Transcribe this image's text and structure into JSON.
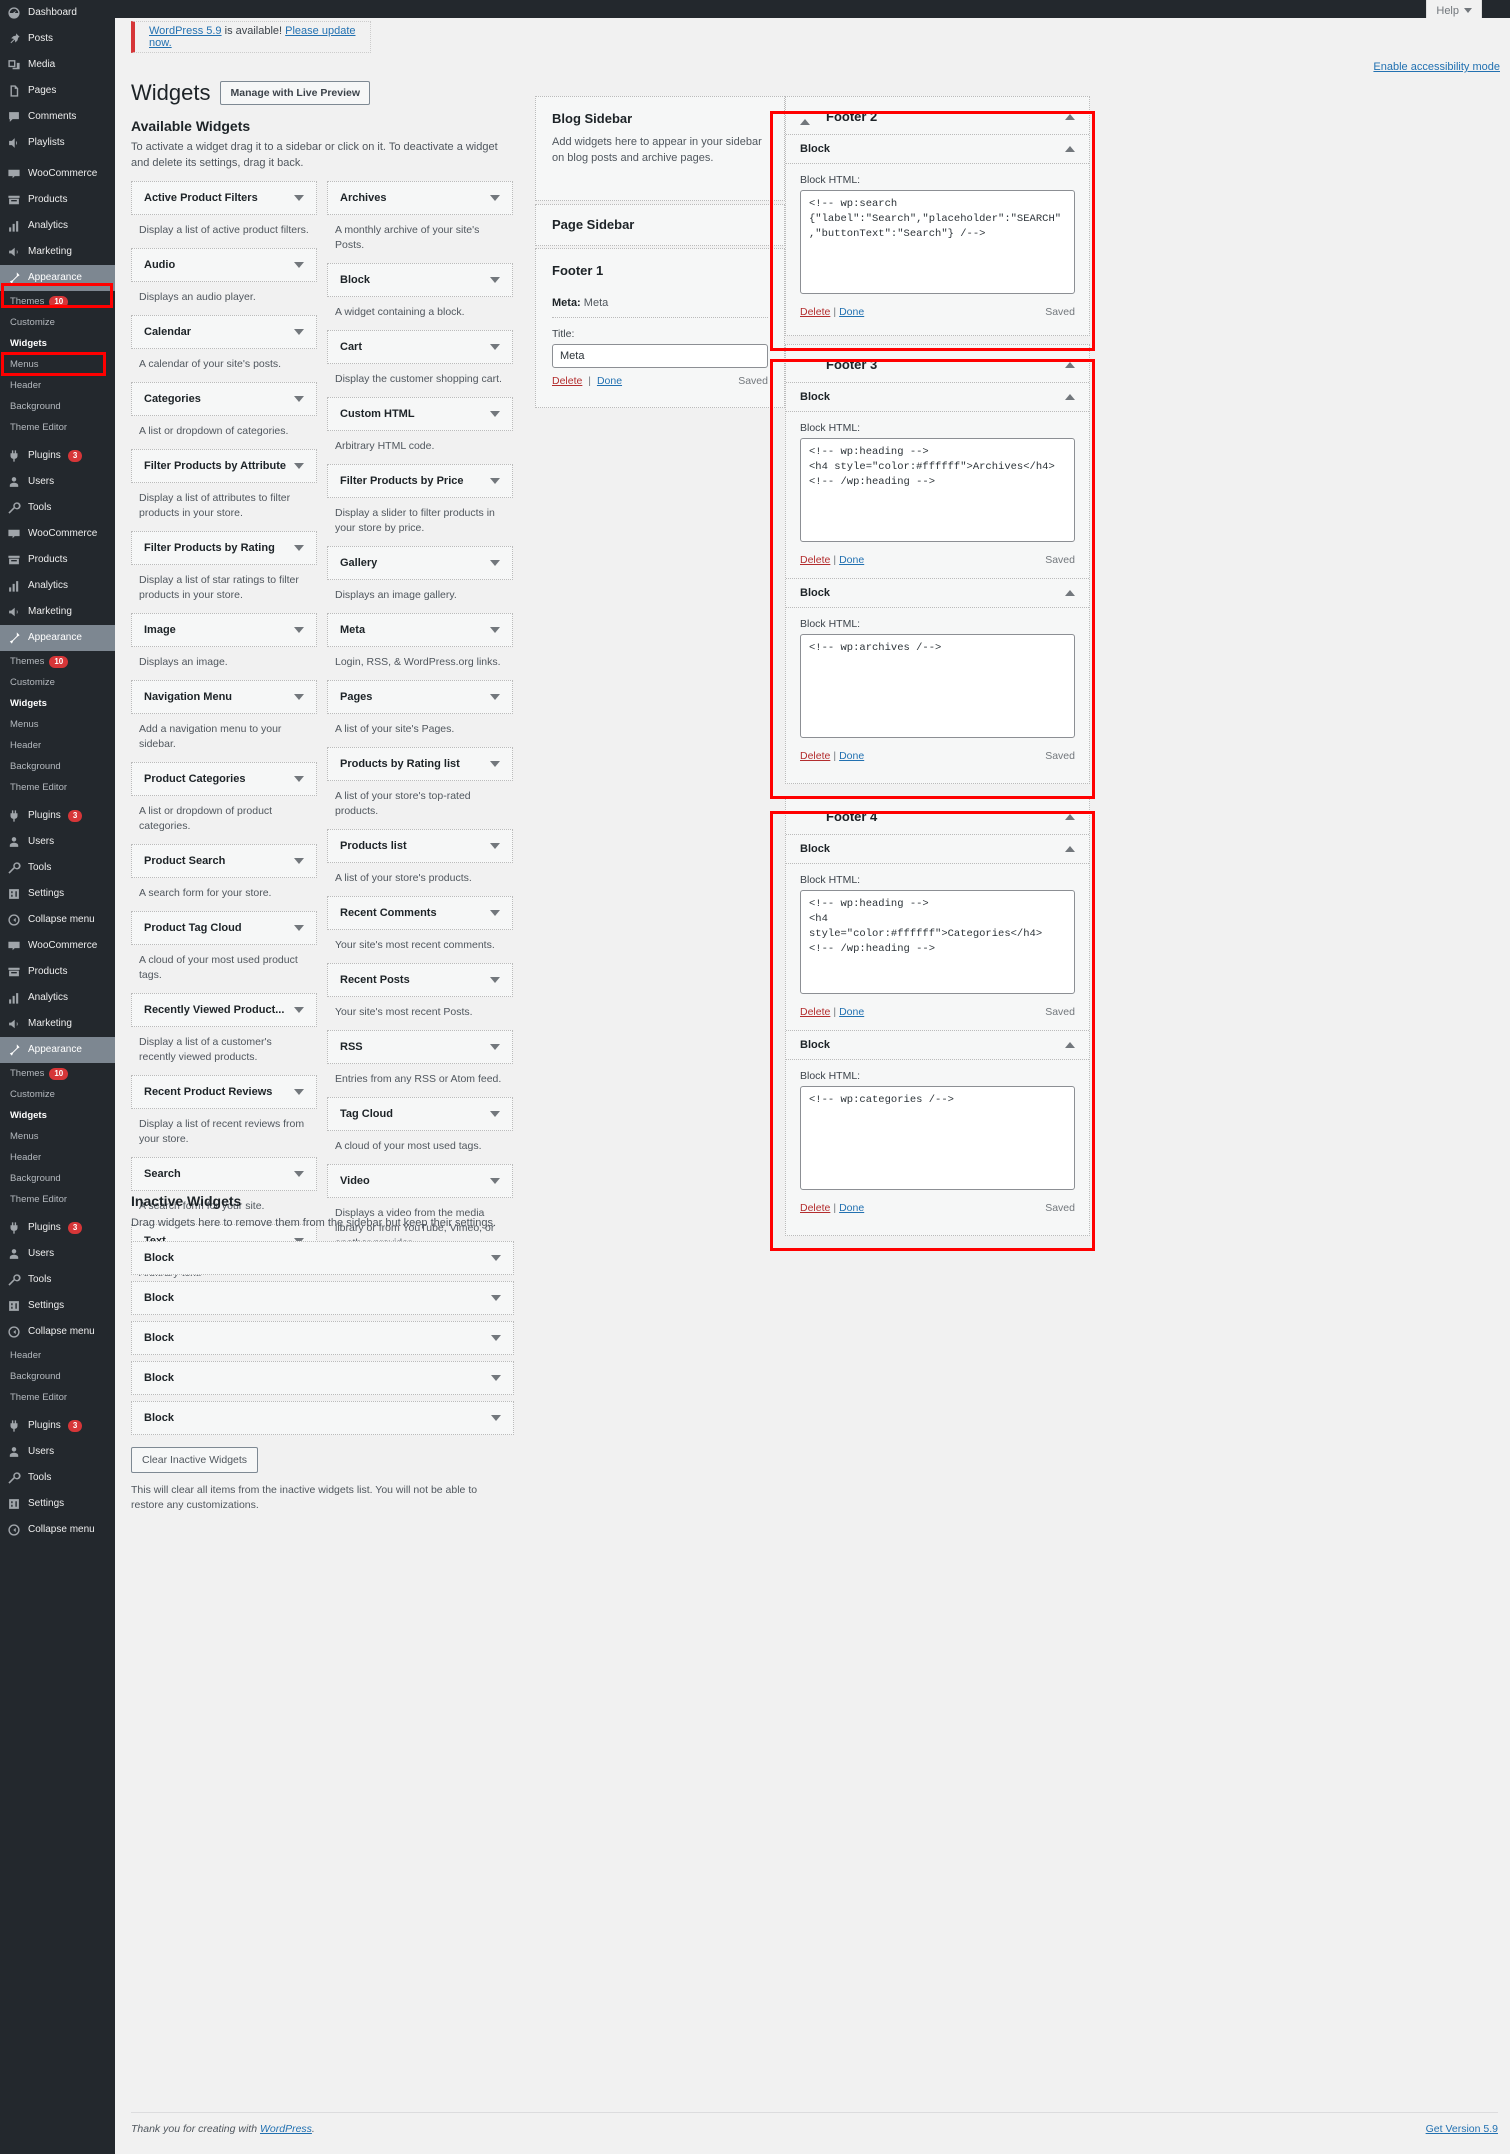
{
  "topbar": {
    "help_label": "Help"
  },
  "notice": {
    "link_text": "WordPress 5.9",
    "middle_text": " is available! ",
    "update_link": "Please update now."
  },
  "accessibility_link": "Enable accessibility mode",
  "page": {
    "title": "Widgets",
    "live_preview_button": "Manage with Live Preview"
  },
  "available": {
    "heading": "Available Widgets",
    "description": "To activate a widget drag it to a sidebar or click on it. To deactivate a widget and delete its settings, drag it back.",
    "left_column": [
      {
        "name": "Active Product Filters",
        "desc": "Display a list of active product filters."
      },
      {
        "name": "Audio",
        "desc": "Displays an audio player."
      },
      {
        "name": "Calendar",
        "desc": "A calendar of your site's posts."
      },
      {
        "name": "Categories",
        "desc": "A list or dropdown of categories."
      },
      {
        "name": "Filter Products by Attribute",
        "desc": "Display a list of attributes to filter products in your store."
      },
      {
        "name": "Filter Products by Rating",
        "desc": "Display a list of star ratings to filter products in your store."
      },
      {
        "name": "Image",
        "desc": "Displays an image."
      },
      {
        "name": "Navigation Menu",
        "desc": "Add a navigation menu to your sidebar."
      },
      {
        "name": "Product Categories",
        "desc": "A list or dropdown of product categories."
      },
      {
        "name": "Product Search",
        "desc": "A search form for your store."
      },
      {
        "name": "Product Tag Cloud",
        "desc": "A cloud of your most used product tags."
      },
      {
        "name": "Recently Viewed Product...",
        "desc": "Display a list of a customer's recently viewed products."
      },
      {
        "name": "Recent Product Reviews",
        "desc": "Display a list of recent reviews from your store."
      },
      {
        "name": "Search",
        "desc": "A search form for your site."
      },
      {
        "name": "Text",
        "desc": "Arbitrary text."
      }
    ],
    "right_column": [
      {
        "name": "Archives",
        "desc": "A monthly archive of your site's Posts."
      },
      {
        "name": "Block",
        "desc": "A widget containing a block."
      },
      {
        "name": "Cart",
        "desc": "Display the customer shopping cart."
      },
      {
        "name": "Custom HTML",
        "desc": "Arbitrary HTML code."
      },
      {
        "name": "Filter Products by Price",
        "desc": "Display a slider to filter products in your store by price."
      },
      {
        "name": "Gallery",
        "desc": "Displays an image gallery."
      },
      {
        "name": "Meta",
        "desc": "Login, RSS, & WordPress.org links."
      },
      {
        "name": "Pages",
        "desc": "A list of your site's Pages."
      },
      {
        "name": "Products by Rating list",
        "desc": "A list of your store's top-rated products."
      },
      {
        "name": "Products list",
        "desc": "A list of your store's products."
      },
      {
        "name": "Recent Comments",
        "desc": "Your site's most recent comments."
      },
      {
        "name": "Recent Posts",
        "desc": "Your site's most recent Posts."
      },
      {
        "name": "RSS",
        "desc": "Entries from any RSS or Atom feed."
      },
      {
        "name": "Tag Cloud",
        "desc": "A cloud of your most used tags."
      },
      {
        "name": "Video",
        "desc": "Displays a video from the media library or from YouTube, Vimeo, or another provider."
      }
    ]
  },
  "inactive": {
    "heading": "Inactive Widgets",
    "description": "Drag widgets here to remove them from the sidebar but keep their settings.",
    "items": [
      {
        "name": "Block"
      },
      {
        "name": "Block"
      },
      {
        "name": "Block"
      },
      {
        "name": "Block"
      },
      {
        "name": "Block"
      }
    ],
    "clear_button": "Clear Inactive Widgets",
    "clear_note": "This will clear all items from the inactive widgets list. You will not be able to restore any customizations."
  },
  "sidebars": {
    "blog": {
      "title": "Blog Sidebar",
      "description": "Add widgets here to appear in your sidebar on blog posts and archive pages."
    },
    "page": {
      "title": "Page Sidebar"
    },
    "footer1": {
      "title": "Footer 1",
      "widget": {
        "head_label": "Meta:",
        "head_value": "Meta",
        "field_label": "Title:",
        "value": "Meta",
        "delete": "Delete",
        "separator": "|",
        "done": "Done",
        "status": "Saved"
      }
    },
    "footer2": {
      "title": "Footer 2",
      "blocks": [
        {
          "head": "Block",
          "field_label": "Block HTML:",
          "code": "<!-- wp:search {\"label\":\"Search\",\"placeholder\":\"SEARCH\",\"buttonText\":\"Search\"} /-->",
          "delete": "Delete",
          "separator": "|",
          "done": "Done",
          "status": "Saved"
        }
      ]
    },
    "footer3": {
      "title": "Footer 3",
      "blocks": [
        {
          "head": "Block",
          "field_label": "Block HTML:",
          "code": "<!-- wp:heading -->\n<h4 style=\"color:#ffffff\">Archives</h4>\n<!-- /wp:heading -->",
          "delete": "Delete",
          "separator": "|",
          "done": "Done",
          "status": "Saved"
        },
        {
          "head": "Block",
          "field_label": "Block HTML:",
          "code": "<!-- wp:archives /-->",
          "delete": "Delete",
          "separator": "|",
          "done": "Done",
          "status": "Saved"
        }
      ]
    },
    "footer4": {
      "title": "Footer 4",
      "blocks": [
        {
          "head": "Block",
          "field_label": "Block HTML:",
          "code": "<!-- wp:heading -->\n<h4 style=\"color:#ffffff\">Categories</h4>\n<!-- /wp:heading -->",
          "delete": "Delete",
          "separator": "|",
          "done": "Done",
          "status": "Saved"
        },
        {
          "head": "Block",
          "field_label": "Block HTML:",
          "code": "<!-- wp:categories /-->",
          "delete": "Delete",
          "separator": "|",
          "done": "Done",
          "status": "Saved"
        }
      ]
    }
  },
  "footer": {
    "thankyou_prefix": "Thank you for creating with ",
    "thankyou_link": "WordPress",
    "thankyou_suffix": ".",
    "version": "Get Version 5.9"
  },
  "menu": {
    "blocks": [
      {
        "top": [
          {
            "label": "Dashboard",
            "icon": "dashboard-icon"
          },
          {
            "label": "Posts",
            "icon": "pin-icon"
          },
          {
            "label": "Media",
            "icon": "media-icon"
          },
          {
            "label": "Pages",
            "icon": "pages-icon"
          },
          {
            "label": "Comments",
            "icon": "comments-icon"
          },
          {
            "label": "Playlists",
            "icon": "playlist-icon"
          },
          {
            "label": "WooCommerce",
            "icon": "woocommerce-icon",
            "gap": true
          },
          {
            "label": "Products",
            "icon": "products-icon"
          },
          {
            "label": "Analytics",
            "icon": "analytics-icon"
          },
          {
            "label": "Marketing",
            "icon": "marketing-icon"
          },
          {
            "label": "Appearance",
            "icon": "appearance-icon",
            "current": true
          }
        ],
        "sub": [
          {
            "label": "Themes",
            "badge": "10"
          },
          {
            "label": "Customize"
          },
          {
            "label": "Widgets",
            "current": true
          },
          {
            "label": "Menus"
          },
          {
            "label": "Header"
          },
          {
            "label": "Background"
          },
          {
            "label": "Theme Editor"
          }
        ],
        "after": [
          {
            "label": "Plugins",
            "icon": "plugins-icon",
            "badge": "3"
          },
          {
            "label": "Users",
            "icon": "users-icon"
          },
          {
            "label": "Tools",
            "icon": "tools-icon"
          }
        ]
      },
      {
        "top": [
          {
            "label": "WooCommerce",
            "icon": "woocommerce-icon"
          },
          {
            "label": "Products",
            "icon": "products-icon"
          },
          {
            "label": "Analytics",
            "icon": "analytics-icon"
          },
          {
            "label": "Marketing",
            "icon": "marketing-icon"
          },
          {
            "label": "Appearance",
            "icon": "appearance-icon",
            "current": true
          }
        ],
        "sub": [
          {
            "label": "Themes",
            "badge": "10"
          },
          {
            "label": "Customize"
          },
          {
            "label": "Widgets",
            "current": true
          },
          {
            "label": "Menus"
          },
          {
            "label": "Header"
          },
          {
            "label": "Background"
          },
          {
            "label": "Theme Editor"
          }
        ],
        "after": [
          {
            "label": "Plugins",
            "icon": "plugins-icon",
            "badge": "3"
          },
          {
            "label": "Users",
            "icon": "users-icon"
          },
          {
            "label": "Tools",
            "icon": "tools-icon"
          },
          {
            "label": "Settings",
            "icon": "settings-icon"
          },
          {
            "label": "Collapse menu",
            "icon": "collapse-icon"
          }
        ]
      },
      {
        "top": [
          {
            "label": "WooCommerce",
            "icon": "woocommerce-icon"
          },
          {
            "label": "Products",
            "icon": "products-icon"
          },
          {
            "label": "Analytics",
            "icon": "analytics-icon"
          },
          {
            "label": "Marketing",
            "icon": "marketing-icon"
          },
          {
            "label": "Appearance",
            "icon": "appearance-icon",
            "current": true
          }
        ],
        "sub": [
          {
            "label": "Themes",
            "badge": "10"
          },
          {
            "label": "Customize"
          },
          {
            "label": "Widgets",
            "current": true
          },
          {
            "label": "Menus"
          },
          {
            "label": "Header"
          },
          {
            "label": "Background"
          },
          {
            "label": "Theme Editor"
          }
        ],
        "after": [
          {
            "label": "Plugins",
            "icon": "plugins-icon",
            "badge": "3"
          },
          {
            "label": "Users",
            "icon": "users-icon"
          },
          {
            "label": "Tools",
            "icon": "tools-icon"
          },
          {
            "label": "Settings",
            "icon": "settings-icon"
          },
          {
            "label": "Collapse menu",
            "icon": "collapse-icon"
          }
        ]
      },
      {
        "top": [],
        "sub": [
          {
            "label": "Header"
          },
          {
            "label": "Background"
          },
          {
            "label": "Theme Editor"
          }
        ],
        "after": [
          {
            "label": "Plugins",
            "icon": "plugins-icon",
            "badge": "3"
          },
          {
            "label": "Users",
            "icon": "users-icon"
          },
          {
            "label": "Tools",
            "icon": "tools-icon"
          },
          {
            "label": "Settings",
            "icon": "settings-icon"
          },
          {
            "label": "Collapse menu",
            "icon": "collapse-icon"
          }
        ]
      }
    ]
  },
  "colors": {
    "accent": "#2271b1",
    "danger": "#d63638",
    "menu_bg": "#23282d",
    "highlight": "#ff0000"
  }
}
